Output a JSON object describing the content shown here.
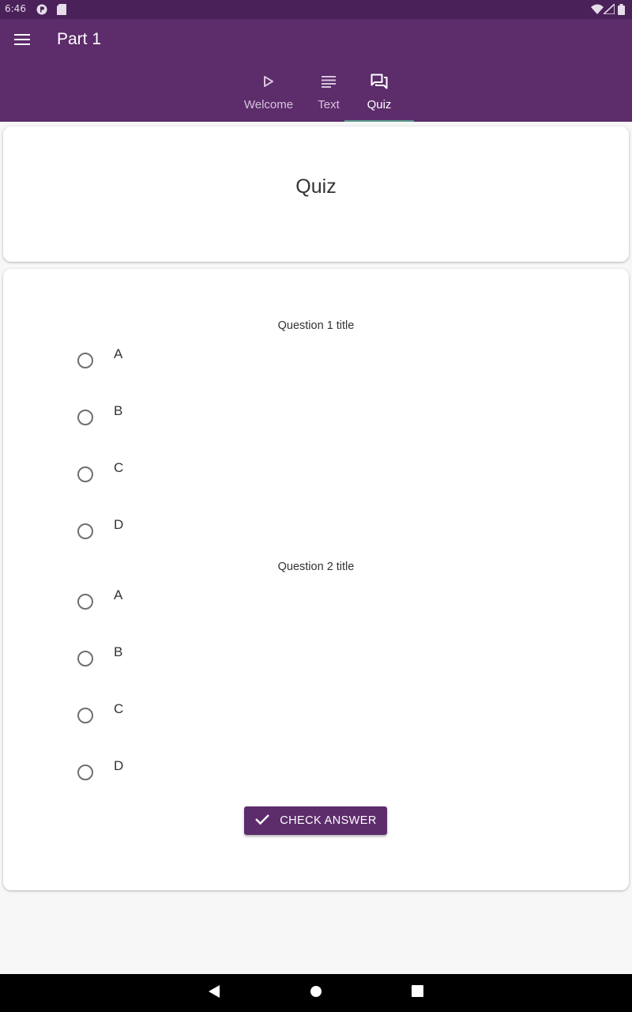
{
  "status_bar": {
    "time": "6:46"
  },
  "app_bar": {
    "title": "Part 1"
  },
  "tabs": [
    {
      "label": "Welcome",
      "icon": "play-icon"
    },
    {
      "label": "Text",
      "icon": "text-lines-icon"
    },
    {
      "label": "Quiz",
      "icon": "forum-icon",
      "active": true
    }
  ],
  "title_card": {
    "heading": "Quiz"
  },
  "quiz": {
    "questions": [
      {
        "title": "Question 1 title",
        "options": [
          "A",
          "B",
          "C",
          "D"
        ]
      },
      {
        "title": "Question 2 title",
        "options": [
          "A",
          "B",
          "C",
          "D"
        ]
      }
    ],
    "check_button_label": "CHECK ANSWER"
  },
  "colors": {
    "primary": "#5d2c6b",
    "status_bar": "#4a2159",
    "tab_indicator": "#5b9a8b"
  }
}
